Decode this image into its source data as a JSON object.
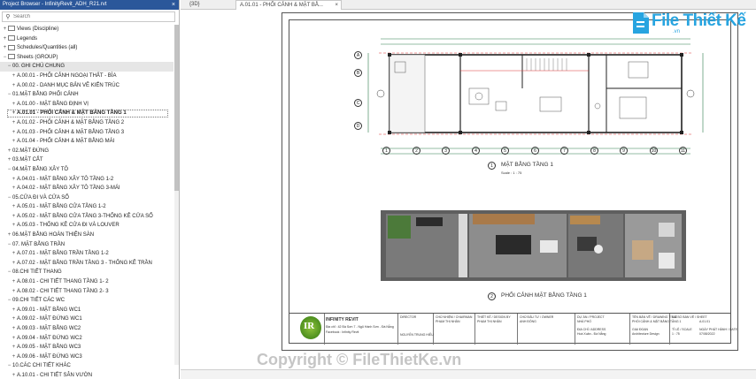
{
  "browser": {
    "title": "Project Browser - InfinityRevit_ADH_R21.rvt",
    "close": "×",
    "search_placeholder": "Search",
    "items": [
      {
        "indent": 0,
        "toggle": "+",
        "icon": true,
        "label": "Views (Discipline)"
      },
      {
        "indent": 0,
        "toggle": "+",
        "icon": true,
        "label": "Legends"
      },
      {
        "indent": 0,
        "toggle": "+",
        "icon": true,
        "label": "Schedules/Quantities (all)"
      },
      {
        "indent": 0,
        "toggle": "−",
        "icon": true,
        "label": "Sheets (GROUP)"
      },
      {
        "indent": 1,
        "toggle": "−",
        "icon": false,
        "label": "00. GHI CHÚ CHUNG",
        "hl": true
      },
      {
        "indent": 2,
        "toggle": "+",
        "icon": false,
        "label": "A.00.01 - PHỐI CẢNH NGOẠI THẤT - BÌA"
      },
      {
        "indent": 2,
        "toggle": "+",
        "icon": false,
        "label": "A.00.02 - DANH MỤC BẢN VẼ KIẾN TRÚC"
      },
      {
        "indent": 1,
        "toggle": "−",
        "icon": false,
        "label": "01.MẶT BẰNG PHỐI CẢNH"
      },
      {
        "indent": 2,
        "toggle": "+",
        "icon": false,
        "label": "A.01.00 - MẶT BẰNG ĐỊNH VỊ"
      },
      {
        "indent": 2,
        "toggle": "+",
        "icon": false,
        "label": "A.01.01 - PHỐI CẢNH & MẶT BẰNG TẦNG 1",
        "sel": true
      },
      {
        "indent": 2,
        "toggle": "+",
        "icon": false,
        "label": "A.01.02 - PHỐI CẢNH & MẶT BẰNG TẦNG 2"
      },
      {
        "indent": 2,
        "toggle": "+",
        "icon": false,
        "label": "A.01.03 - PHỐI CẢNH & MẶT BẰNG TẦNG 3"
      },
      {
        "indent": 2,
        "toggle": "+",
        "icon": false,
        "label": "A.01.04 - PHỐI CẢNH & MẶT BẰNG MÁI"
      },
      {
        "indent": 1,
        "toggle": "+",
        "icon": false,
        "label": "02.MẶT ĐỨNG"
      },
      {
        "indent": 1,
        "toggle": "+",
        "icon": false,
        "label": "03.MẶT CẮT"
      },
      {
        "indent": 1,
        "toggle": "−",
        "icon": false,
        "label": "04.MẶT BẰNG XÂY TÔ"
      },
      {
        "indent": 2,
        "toggle": "+",
        "icon": false,
        "label": "A.04.01 - MẶT BẰNG XÂY TÔ TẦNG 1-2"
      },
      {
        "indent": 2,
        "toggle": "+",
        "icon": false,
        "label": "A.04.02 - MẶT BẰNG XÂY TÔ TẦNG 3-MÁI"
      },
      {
        "indent": 1,
        "toggle": "−",
        "icon": false,
        "label": "05.CỬA ĐI VÀ CỬA SỔ"
      },
      {
        "indent": 2,
        "toggle": "+",
        "icon": false,
        "label": "A.05.01 - MẶT BẰNG CỬA TẦNG 1-2"
      },
      {
        "indent": 2,
        "toggle": "+",
        "icon": false,
        "label": "A.05.02 - MẶT BẰNG CỬA TẦNG 3-THỐNG KÊ CỬA SỔ"
      },
      {
        "indent": 2,
        "toggle": "+",
        "icon": false,
        "label": "A.05.03 - THỐNG KÊ CỬA ĐI VÀ LOUVER"
      },
      {
        "indent": 1,
        "toggle": "+",
        "icon": false,
        "label": "06.MẶT BẰNG HOÀN THIỆN SÀN"
      },
      {
        "indent": 1,
        "toggle": "−",
        "icon": false,
        "label": "07. MẶT BẰNG TRẦN"
      },
      {
        "indent": 2,
        "toggle": "+",
        "icon": false,
        "label": "A.07.01 - MẶT BẰNG TRẦN TẦNG 1-2"
      },
      {
        "indent": 2,
        "toggle": "+",
        "icon": false,
        "label": "A.07.02 - MẶT BẰNG TRẦN TẦNG 3 - THỐNG KÊ TRẦN"
      },
      {
        "indent": 1,
        "toggle": "−",
        "icon": false,
        "label": "08.CHI TIẾT THANG"
      },
      {
        "indent": 2,
        "toggle": "+",
        "icon": false,
        "label": "A.08.01 - CHI TIẾT THANG TẦNG 1- 2"
      },
      {
        "indent": 2,
        "toggle": "+",
        "icon": false,
        "label": "A.08.02 - CHI TIẾT THANG TẦNG 2- 3"
      },
      {
        "indent": 1,
        "toggle": "−",
        "icon": false,
        "label": "09.CHI TIẾT CÁC WC"
      },
      {
        "indent": 2,
        "toggle": "+",
        "icon": false,
        "label": "A.09.01 - MẶT BẰNG WC1"
      },
      {
        "indent": 2,
        "toggle": "+",
        "icon": false,
        "label": "A.09.02 - MẶT ĐỨNG WC1"
      },
      {
        "indent": 2,
        "toggle": "+",
        "icon": false,
        "label": "A.09.03 - MẶT BẰNG WC2"
      },
      {
        "indent": 2,
        "toggle": "+",
        "icon": false,
        "label": "A.09.04 - MẶT ĐỨNG WC2"
      },
      {
        "indent": 2,
        "toggle": "+",
        "icon": false,
        "label": "A.09.05 - MẶT BẰNG WC3"
      },
      {
        "indent": 2,
        "toggle": "+",
        "icon": false,
        "label": "A.09.06 - MẶT ĐỨNG WC3"
      },
      {
        "indent": 1,
        "toggle": "−",
        "icon": false,
        "label": "10.CÁC CHI TIẾT KHÁC"
      },
      {
        "indent": 2,
        "toggle": "+",
        "icon": false,
        "label": "A.10.01 - CHI TIẾT SÂN VƯỜN"
      },
      {
        "indent": 2,
        "toggle": "+",
        "icon": false,
        "label": "A.10.02 - CHI TIẾT MÁI KÍNH GIẾNG TRỜI - NẮP THANG"
      }
    ]
  },
  "tabs": {
    "tab_3d": "{3D}",
    "tab_active": "A.01.01 - PHỐI CẢNH & MẶT BẰ...",
    "close": "×"
  },
  "sheet": {
    "plan_title": "MẶT BẰNG TẦNG 1",
    "plan_scale": "Scale : 1 : 75",
    "plan_num": "1",
    "render_title": "PHỐI CẢNH MẶT BẰNG TẦNG 1",
    "render_num": "2",
    "grid_letters": [
      "A",
      "B",
      "C",
      "D"
    ],
    "grid_numbers": [
      "1",
      "2",
      "3",
      "4",
      "5",
      "6",
      "7",
      "8",
      "9",
      "10",
      "11"
    ]
  },
  "titleblock": {
    "logo_text": "IR",
    "company": "INFINITY REVIT",
    "address": "Địa chỉ : 42 Đà Sơn 7 - Ngũ Hành Sơn - Đà Nẵng",
    "contact": "Facebook : Infinity Revit",
    "director_label": "DIRECTOR",
    "director_name": "NGUYỄN TRUNG HIẾU",
    "chairman_label": "CHỦ NHIỆM / CHAIRMAN",
    "chairman_name": "PHẠM THỊ NHÂN",
    "design_label": "THIẾT KẾ / DESIGN BY",
    "design_name": "PHẠM THỊ NHÂN",
    "owner_label": "CHỦ ĐẦU TƯ / OWNER",
    "owner_name": "ANH ĐÔNG",
    "project_label": "DỰ ÁN / PROJECT",
    "project_name": "NHÀ PHỐ",
    "location_label": "ĐỊA CHỈ / ADDRESS",
    "location_name": "Hoà Xuân - Đà Nẵng",
    "phase_label": "GIAI ĐOẠN",
    "phase_name": "Architecture Design",
    "sheet_name_label": "TÊN BẢN VẼ / DRAWING TITLE",
    "sheet_name": "PHỐI CẢNH & MẶT BẰNG TẦNG 1",
    "scale_label": "TỈ LỆ / SCALE",
    "scale_value": "1 : 75",
    "sheet_no_label": "MÃ SỐ BẢN VẼ / SHEET",
    "sheet_no": "A.01.01",
    "date_label": "NGÀY PHÁT HÀNH / DATE",
    "date_value": "07/08/2022"
  },
  "brand": {
    "name": "File Thiết Kế",
    "sub": ".vn"
  },
  "watermark": "Copyright © FileThietKe.vn",
  "colors": {
    "accent": "#2b579a",
    "brand": "#27a4e0",
    "logo": "#6aa62a"
  }
}
